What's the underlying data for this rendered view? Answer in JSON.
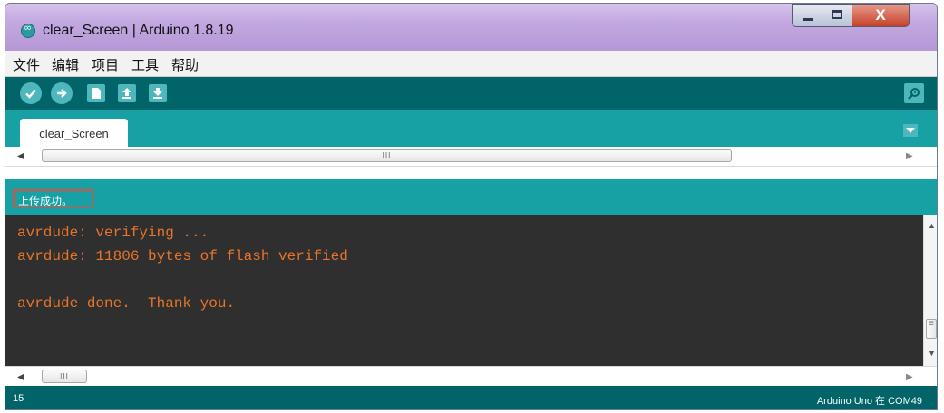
{
  "window": {
    "title": "clear_Screen | Arduino 1.8.19",
    "close_label": "X"
  },
  "menu": [
    "文件",
    "编辑",
    "项目",
    "工具",
    "帮助"
  ],
  "toolbar": {
    "icons": [
      "verify-icon",
      "upload-icon",
      "new-icon",
      "open-icon",
      "save-icon",
      "serial-monitor-icon"
    ],
    "accent_color": "#4db7bb",
    "bar_color": "#006468"
  },
  "tabs": [
    {
      "label": "clear_Screen"
    }
  ],
  "scroll": {
    "grip": "III"
  },
  "status": {
    "message": "上传成功。",
    "highlight_color": "#e0503e"
  },
  "console": {
    "lines": [
      "avrdude: verifying ...",
      "avrdude: 11806 bytes of flash verified",
      "",
      "avrdude done.  Thank you."
    ],
    "text_color": "#e8742a"
  },
  "footer": {
    "line_number": "15",
    "board_info": "Arduino Uno 在 COM49"
  }
}
